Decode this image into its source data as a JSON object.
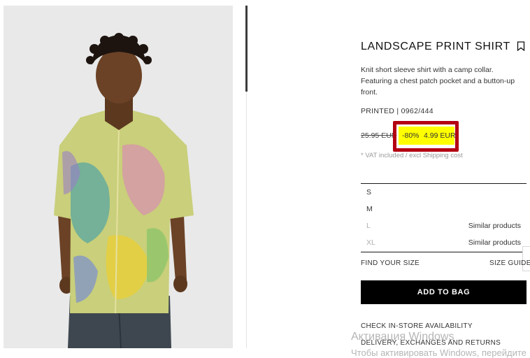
{
  "product": {
    "title": "LANDSCAPE PRINT SHIRT",
    "description": "Knit short sleeve shirt with a camp collar. Featuring a chest patch pocket and a button-up front.",
    "reference": "PRINTED | 0962/444",
    "price_old": "25.95 EUR",
    "discount": "-80%",
    "price_new": "4.99 EUR",
    "vat_note": "* VAT included / excl Shipping cost"
  },
  "sizes": [
    {
      "label": "S",
      "note": ""
    },
    {
      "label": "M",
      "note": ""
    },
    {
      "label": "L",
      "note": "Similar products"
    },
    {
      "label": "XL",
      "note": "Similar products"
    }
  ],
  "links": {
    "find_size": "FIND YOUR SIZE",
    "size_guide": "SIZE GUIDE",
    "add_to_bag": "ADD TO BAG",
    "check_store": "CHECK IN-STORE AVAILABILITY",
    "delivery": "DELIVERY, EXCHANGES AND RETURNS"
  },
  "watermark": {
    "line1": "Активация Windows",
    "line2": "Чтобы активировать Windows, перейдите"
  },
  "colors": {
    "price_highlight": "#ffff00",
    "annotation_box": "#b30012",
    "button_bg": "#000000"
  },
  "icons": [
    "bookmark-icon"
  ]
}
